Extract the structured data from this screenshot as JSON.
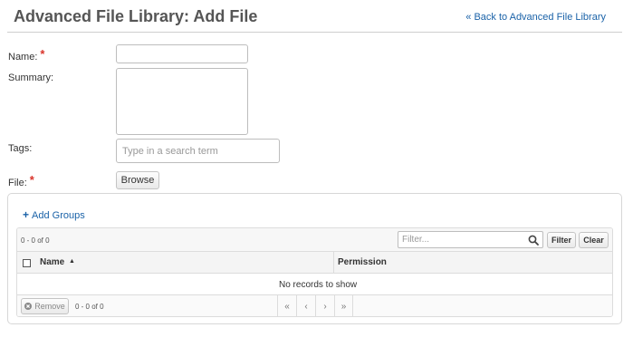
{
  "header": {
    "title": "Advanced File Library: Add File",
    "back_link": "« Back to Advanced File Library"
  },
  "form": {
    "name_label": "Name:",
    "summary_label": "Summary:",
    "tags_label": "Tags:",
    "tags_placeholder": "Type in a search term",
    "file_label": "File:",
    "required_mark": "*",
    "browse_label": "Browse"
  },
  "groups": {
    "add_label": "Add Groups",
    "add_icon": "plus-icon",
    "top_count": "0 - 0 of 0",
    "filter_placeholder": "Filter...",
    "filter_button": "Filter",
    "clear_button": "Clear",
    "columns": {
      "name": "Name",
      "permission": "Permission"
    },
    "sort_indicator": "▲",
    "empty_message": "No records to show",
    "remove_label": "Remove",
    "bottom_count": "0 - 0 of 0",
    "pager": [
      "«",
      "‹",
      "›",
      "»"
    ]
  },
  "colors": {
    "link": "#1a62a8",
    "required": "#d9342b"
  }
}
